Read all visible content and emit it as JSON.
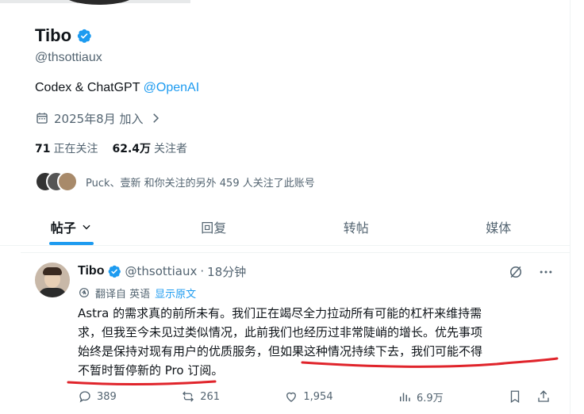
{
  "profile": {
    "name": "Tibo",
    "handle": "@thsottiaux",
    "bio_prefix": "Codex & ChatGPT ",
    "bio_mention": "@OpenAI",
    "joined": "2025年8月 加入",
    "following_count": "71",
    "following_label": "正在关注",
    "followers_count": "62.4万",
    "followers_label": "关注者",
    "followers_you_know": "Puck、壹新 和你关注的另外 459 人关注了此账号"
  },
  "tabs": [
    {
      "label": "帖子"
    },
    {
      "label": "回复"
    },
    {
      "label": "转帖"
    },
    {
      "label": "媒体"
    }
  ],
  "tweet": {
    "name": "Tibo",
    "handle": "@thsottiaux",
    "dot": "·",
    "time": "18分钟",
    "translated_from": "翻译自 英语",
    "show_original": "显示原文",
    "body_line1": "Astra 的需求真的前所未有。我们正在竭尽全力拉动所有可能的杠杆来维持需",
    "body_line2": "求，但我至今未见过类似情况，此前我们也经历过非常陡峭的增长。优先事项",
    "body_line3": "始终是保持对现有用户的优质服务，但如果这种情况持续下去，我们可能不得",
    "body_line4": "不暂时暂停新的 Pro 订阅。",
    "replies": "389",
    "reposts": "261",
    "likes": "1,954",
    "views": "6.9万"
  },
  "colors": {
    "accent": "#1d9bf0",
    "muted": "#536471",
    "text": "#0f1419",
    "annotation": "#e0242b"
  },
  "icons": [
    "verified-badge-icon",
    "calendar-icon",
    "chevron-right-icon",
    "chevron-down-icon",
    "grok-icon",
    "more-icon",
    "translate-icon",
    "reply-icon",
    "repost-icon",
    "like-icon",
    "views-icon",
    "bookmark-icon",
    "share-icon"
  ]
}
